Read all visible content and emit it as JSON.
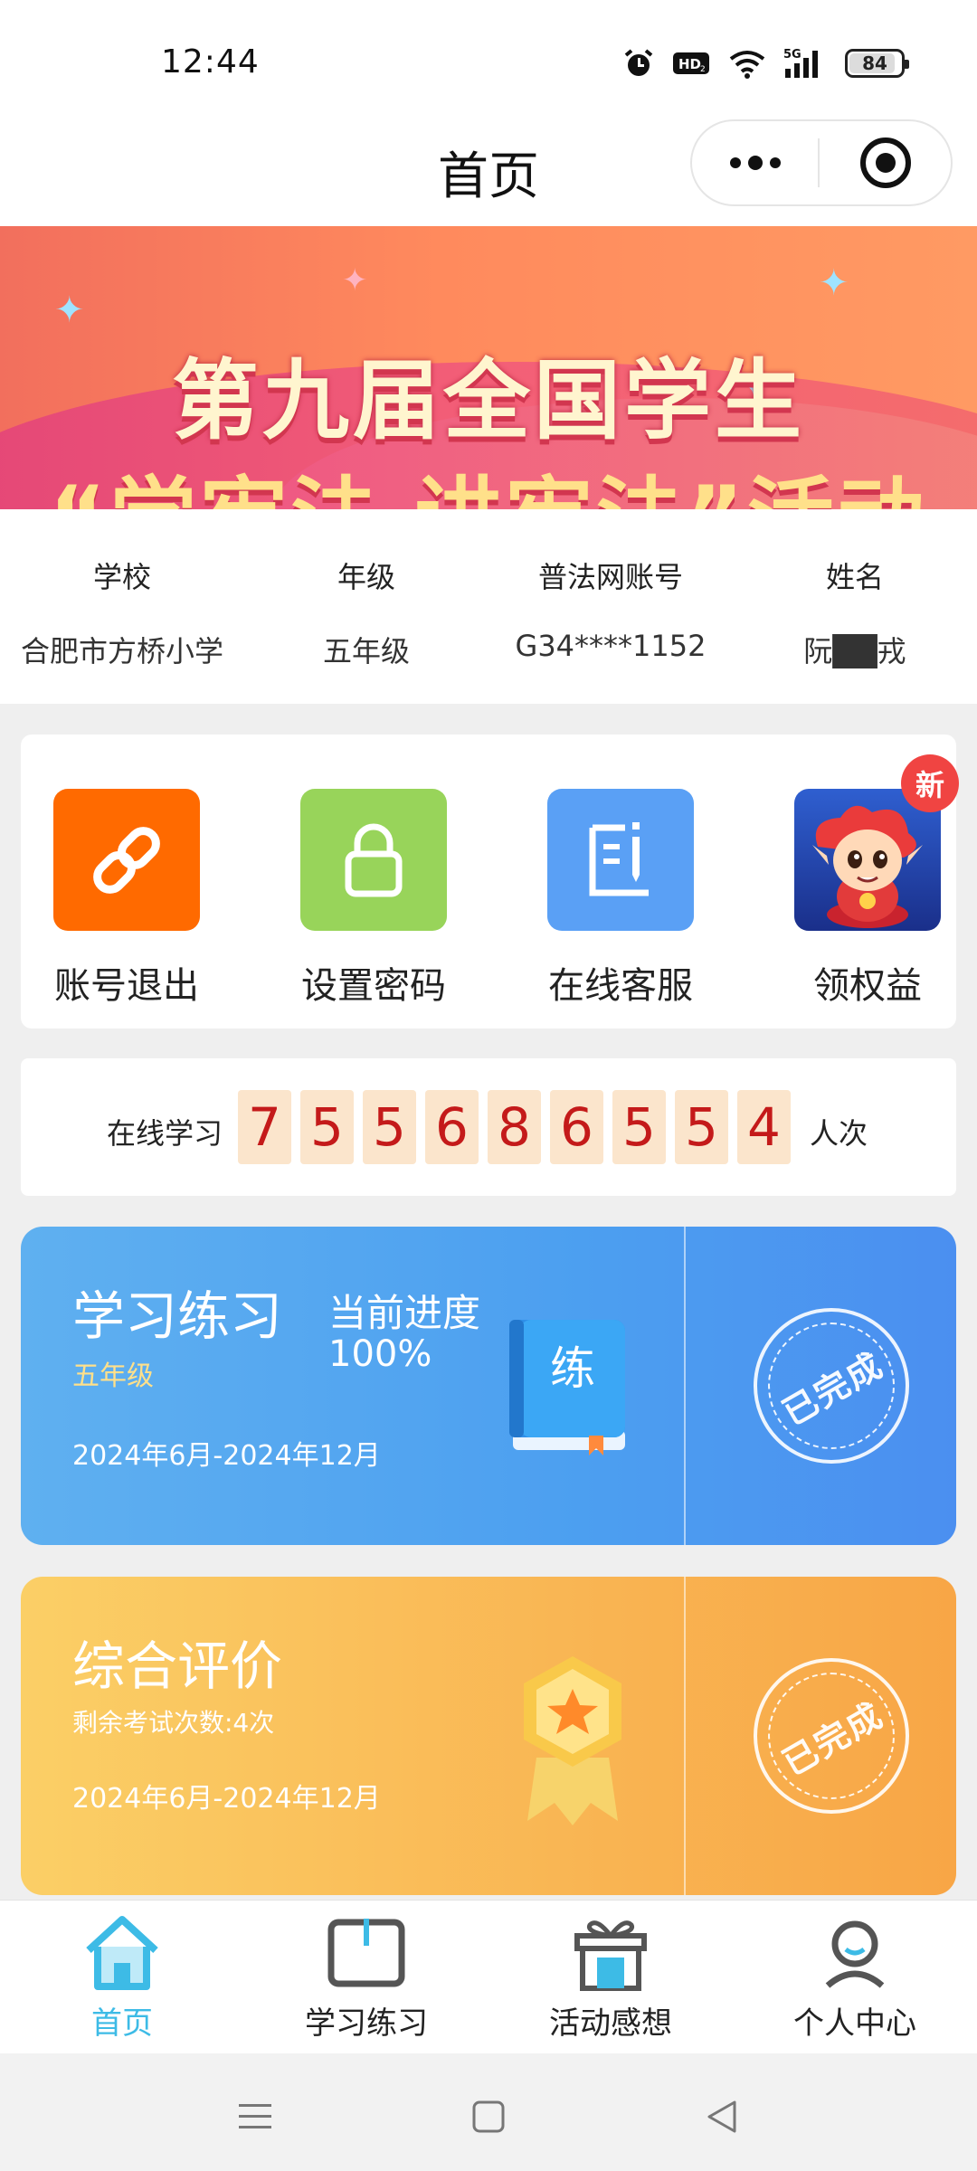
{
  "status_bar": {
    "time": "12:44",
    "network": "5G",
    "hd": "HD",
    "battery": "84",
    "battery_level": 0.84
  },
  "nav": {
    "title": "首页"
  },
  "banner": {
    "line1": "第九届全国学生",
    "line2": "“学宪法 讲宪法”活动"
  },
  "student_info": {
    "school_label": "学校",
    "school_value": "合肥市方桥小学",
    "grade_label": "年级",
    "grade_value": "五年级",
    "account_label": "普法网账号",
    "account_value": "G34****1152",
    "name_label": "姓名",
    "name_value": "阮██戎"
  },
  "actions": [
    {
      "label": "账号退出",
      "icon": "link-icon",
      "color": "#ff6a00"
    },
    {
      "label": "设置密码",
      "icon": "lock-icon",
      "color": "#98d45a"
    },
    {
      "label": "在线客服",
      "icon": "edit-document-icon",
      "color": "#5aa0f5"
    },
    {
      "label": "领权益",
      "icon": "mascot-icon",
      "badge": "新"
    }
  ],
  "online_counter": {
    "prefix": "在线学习",
    "digits": [
      "7",
      "5",
      "5",
      "6",
      "8",
      "6",
      "5",
      "5",
      "4"
    ],
    "suffix": "人次"
  },
  "cards": {
    "practice": {
      "title": "学习练习",
      "grade": "五年级",
      "date_range": "2024年6月-2024年12月",
      "progress_label": "当前进度",
      "progress_value": "100%",
      "book_char": "练",
      "stamp": "已完成"
    },
    "evaluation": {
      "title": "综合评价",
      "remaining": "剩余考试次数:4次",
      "date_range": "2024年6月-2024年12月",
      "stamp": "已完成"
    }
  },
  "tabbar": [
    {
      "label": "首页",
      "icon": "home-icon",
      "active": true
    },
    {
      "label": "学习练习",
      "icon": "book-icon",
      "active": false
    },
    {
      "label": "活动感想",
      "icon": "gift-icon",
      "active": false
    },
    {
      "label": "个人中心",
      "icon": "user-icon",
      "active": false
    }
  ]
}
